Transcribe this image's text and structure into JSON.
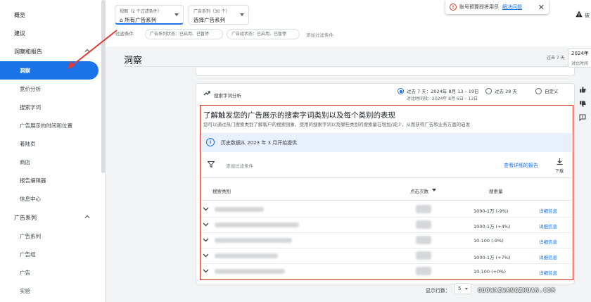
{
  "sidebar": {
    "items": [
      {
        "label": "概览",
        "level": 1
      },
      {
        "label": "建议",
        "level": 1
      },
      {
        "label": "洞察和报告",
        "level": 1,
        "expanded": true
      },
      {
        "label": "洞察",
        "level": 2,
        "selected": true
      },
      {
        "label": "竞价分析",
        "level": 2
      },
      {
        "label": "搜索字词",
        "level": 2
      },
      {
        "label": "广告展示的时间和位置",
        "level": 2
      },
      {
        "label": "着陆页",
        "level": 2
      },
      {
        "label": "商店",
        "level": 2
      },
      {
        "label": "报告编辑器",
        "level": 2
      },
      {
        "label": "信息中心",
        "level": 2
      },
      {
        "label": "广告系列",
        "level": 1,
        "expanded": true
      },
      {
        "label": "广告系列",
        "level": 2
      },
      {
        "label": "广告组",
        "level": 2
      },
      {
        "label": "广告",
        "level": 2
      },
      {
        "label": "实验",
        "level": 2
      }
    ]
  },
  "topbar": {
    "view_chip": {
      "label": "视图（2 个过滤条件）",
      "value": "所有广告系列"
    },
    "campaign_chip": {
      "label": "广告系列（30 个）",
      "value": "选择广告系列"
    },
    "filter_label": "过滤条件",
    "filters": [
      "广告系列状态：已启用、已暂停",
      "广告组状态：已启用、已暂停"
    ],
    "add_filter": "添加过滤条件"
  },
  "notification": {
    "text": "账号预算即将用尽",
    "link": "解决问题"
  },
  "header_right": {
    "warning_text": "被"
  },
  "main": {
    "title": "洞察",
    "range_label": "过去 7 天",
    "date_box": {
      "line1": "2024年",
      "line2": "对比时间"
    }
  },
  "card": {
    "title": "搜索字词分析",
    "radios": [
      {
        "label": "过去 7 天：2024年 8月 13 – 19日",
        "sub": "对比时间段：2024年 8月 6日 – 12日",
        "selected": true
      },
      {
        "label": "过去 28 天",
        "selected": false
      },
      {
        "label": "自定义",
        "selected": false
      }
    ],
    "insight_title": "了解触发您的广告展示的搜索字词类别以及每个类别的表现",
    "insight_desc": "您可以通过热门搜索类别了解客户的搜索则象、使用的搜索字词以及哪些类别的搜索量在增加/减少，从而获得广告和业务方面的启发",
    "info_banner": "历史数据从 2023 年 3 月开始提供",
    "add_filter": "添加过滤条件",
    "view_report": "查看详细的报告",
    "download": "下载",
    "table": {
      "headers": {
        "category": "搜索类别",
        "clicks": "点击次数",
        "volume": "搜索量"
      },
      "rows": [
        {
          "volume": "1000-1万 (-9%)",
          "detail": "详细信息"
        },
        {
          "volume": "1000-1万 (+4%)",
          "detail": "详细信息"
        },
        {
          "volume": "10-100 (-9%)",
          "detail": "详细信息"
        },
        {
          "volume": "1000-1万 (+7%)",
          "detail": "详细信息"
        },
        {
          "volume": "10-100 (+0%)",
          "detail": "详细信息"
        }
      ]
    },
    "pager": {
      "label": "显示行数：",
      "value": "5"
    }
  },
  "watermark": "GUOWAIWANGZHUAN.COM",
  "colors": {
    "accent": "#1a73e8",
    "highlight": "#d93025",
    "info_bg": "#e8f0fe"
  }
}
